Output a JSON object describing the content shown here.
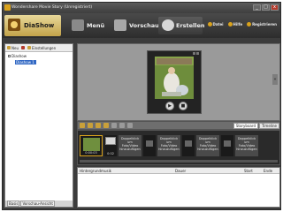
{
  "window": {
    "title": "Wondershare Movie Story (Unregistriert)",
    "buttons": {
      "minimize": "_",
      "maximize": "□",
      "close": "x"
    }
  },
  "app": {
    "brand_label": "DiaShow"
  },
  "nav": {
    "menu": "Menü",
    "vorschau": "Vorschau",
    "erstellen": "Erstellen"
  },
  "top_links": {
    "datei": "Datei",
    "hilfe": "Hilfe",
    "register": "Registrieren"
  },
  "left_panel": {
    "toolbar": {
      "new": "Neu",
      "settings": "Einstellungen"
    },
    "tree_root": "Diashow",
    "tree_child": "Diashow 1",
    "tabs": [
      "Basis",
      "Vorschau-Ansicht"
    ]
  },
  "preview": {
    "side_tab": "«",
    "controls": {
      "play": "▶",
      "stop": "■"
    }
  },
  "tools": {
    "tabs": [
      "Storyboard",
      "Timeline"
    ]
  },
  "storyboard": {
    "photo_time": "0:00:03",
    "transition_time": "0:02",
    "placeholder": "Doppelklick um Foto/Video hinzuzufügen"
  },
  "music": {
    "headers": [
      "Hintergrundmusik",
      "Dauer",
      "Start",
      "Ende"
    ]
  }
}
